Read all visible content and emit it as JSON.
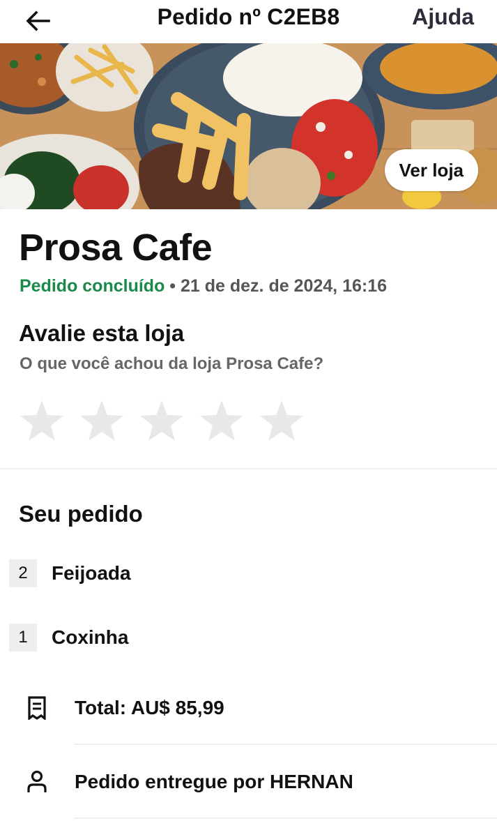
{
  "header": {
    "title": "Pedido nº C2EB8",
    "help_label": "Ajuda",
    "back_icon": "arrow-left-icon"
  },
  "hero": {
    "store_button_label": "Ver loja"
  },
  "store": {
    "name": "Prosa Cafe",
    "status": "Pedido concluído",
    "separator": " • ",
    "date": "21 de dez. de 2024, 16:16"
  },
  "rating": {
    "title": "Avalie esta loja",
    "subtitle": "O que você achou da loja Prosa Cafe?",
    "stars_total": 5,
    "stars_selected": 0,
    "star_icon": "star-icon",
    "star_color": "#e8e8e8"
  },
  "order": {
    "title": "Seu pedido",
    "items": [
      {
        "qty": "2",
        "name": "Feijoada"
      },
      {
        "qty": "1",
        "name": "Coxinha"
      }
    ],
    "total": "Total: AU$ 85,99",
    "delivered_by": "Pedido entregue por HERNAN",
    "receipt_icon": "receipt-icon",
    "person_icon": "person-icon"
  },
  "colors": {
    "status_green": "#1a8a4a",
    "secondary_text": "#666666",
    "divider": "#efefef"
  }
}
